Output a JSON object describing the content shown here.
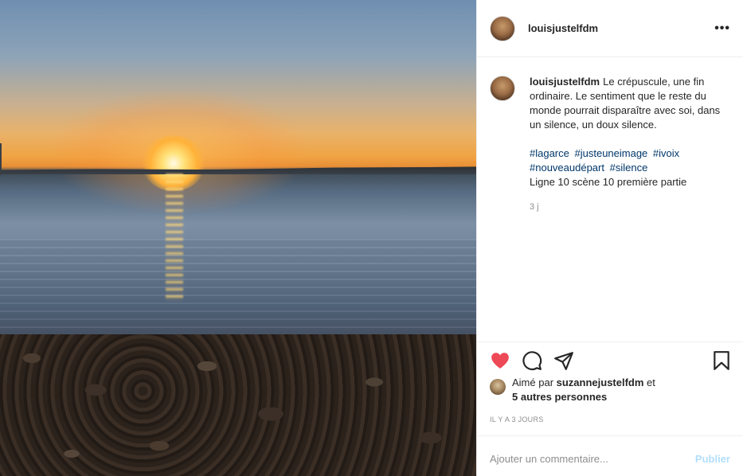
{
  "post": {
    "author": "louisjustelfdm",
    "more_icon": "more-horizontal-icon",
    "caption": {
      "username": "louisjustelfdm",
      "text": "Le crépuscule, une fin ordinaire. Le sentiment que le reste du monde pourrait disparaître avec soi, dans un silence, un doux silence.",
      "hashtags": [
        "#lagarce",
        "#justeuneimage",
        "#ivoix",
        "#nouveaudépart",
        "#silence"
      ],
      "extra_line": "Ligne 10 scène 10 première partie",
      "time": "3 j"
    },
    "actions": {
      "like_icon": "heart-filled-icon",
      "comment_icon": "comment-bubble-icon",
      "share_icon": "paper-plane-icon",
      "save_icon": "bookmark-icon",
      "like_color": "#ed4956"
    },
    "likes": {
      "prefix": "Aimé par ",
      "liked_by": "suzannejustelfdm",
      "connector": " et",
      "others": "5 autres personnes"
    },
    "timestamp": "IL Y A 3 JOURS",
    "comment_box": {
      "placeholder": "Ajouter un commentaire...",
      "post_label": "Publier"
    }
  }
}
